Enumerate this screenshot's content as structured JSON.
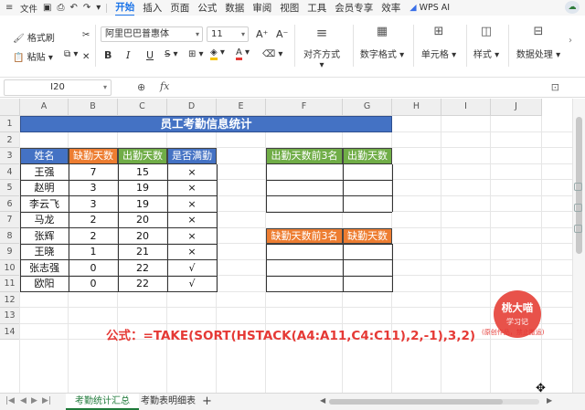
{
  "menu": {
    "file_label": "文件",
    "tabs": [
      "开始",
      "插入",
      "页面",
      "公式",
      "数据",
      "审阅",
      "视图",
      "工具",
      "会员专享",
      "效率"
    ],
    "active_tab": "开始",
    "wps_ai": "WPS AI"
  },
  "ribbon": {
    "format_painter": "格式刷",
    "paste": "粘贴",
    "font_name": "阿里巴巴普惠体",
    "font_size": "11",
    "bold": "B",
    "italic": "I",
    "underline": "U",
    "grow_font": "A⁺",
    "shrink_font": "A⁻",
    "align": "对齐方式",
    "number_format": "数字格式",
    "cells": "单元格",
    "styles": "样式",
    "data_processing": "数据处理"
  },
  "formula_bar": {
    "name_box": "I20",
    "fx": "fx",
    "value": ""
  },
  "columns": [
    "A",
    "B",
    "C",
    "D",
    "E",
    "F",
    "G",
    "H",
    "I",
    "J"
  ],
  "rows": [
    "1",
    "2",
    "3",
    "4",
    "5",
    "6",
    "7",
    "8",
    "9",
    "10",
    "11",
    "12",
    "13",
    "14"
  ],
  "sheet": {
    "title": "员工考勤信息统计",
    "headers": [
      "姓名",
      "缺勤天数",
      "出勤天数",
      "是否满勤"
    ],
    "records": [
      [
        "王强",
        "7",
        "15",
        "×"
      ],
      [
        "赵明",
        "3",
        "19",
        "×"
      ],
      [
        "李云飞",
        "3",
        "19",
        "×"
      ],
      [
        "马龙",
        "2",
        "20",
        "×"
      ],
      [
        "张辉",
        "2",
        "20",
        "×"
      ],
      [
        "王晓",
        "1",
        "21",
        "×"
      ],
      [
        "张志强",
        "0",
        "22",
        "√"
      ],
      [
        "欧阳",
        "0",
        "22",
        "√"
      ]
    ],
    "top_attendance_headers": [
      "出勤天数前3名",
      "出勤天数"
    ],
    "top_absence_headers": [
      "缺勤天数前3名",
      "缺勤天数"
    ],
    "formula_label": "公式：=TAKE(SORT(HSTACK(A4:A11,C4:C11),2,-1),3,2)"
  },
  "watermark": {
    "name": "桃大喵",
    "sub": "学习记",
    "note": "(原创作品，禁止搬运)"
  },
  "sheet_tabs": [
    "考勤统计汇总",
    "考勤表明细表"
  ],
  "active_sheet": "考勤统计汇总",
  "colors": {
    "accent": "#1a73e8",
    "title_blue": "#4472c4",
    "header_orange": "#ed7d31",
    "header_green": "#70ad47",
    "formula_red": "#e53935",
    "sheet_tab_green": "#1f7a3a"
  }
}
